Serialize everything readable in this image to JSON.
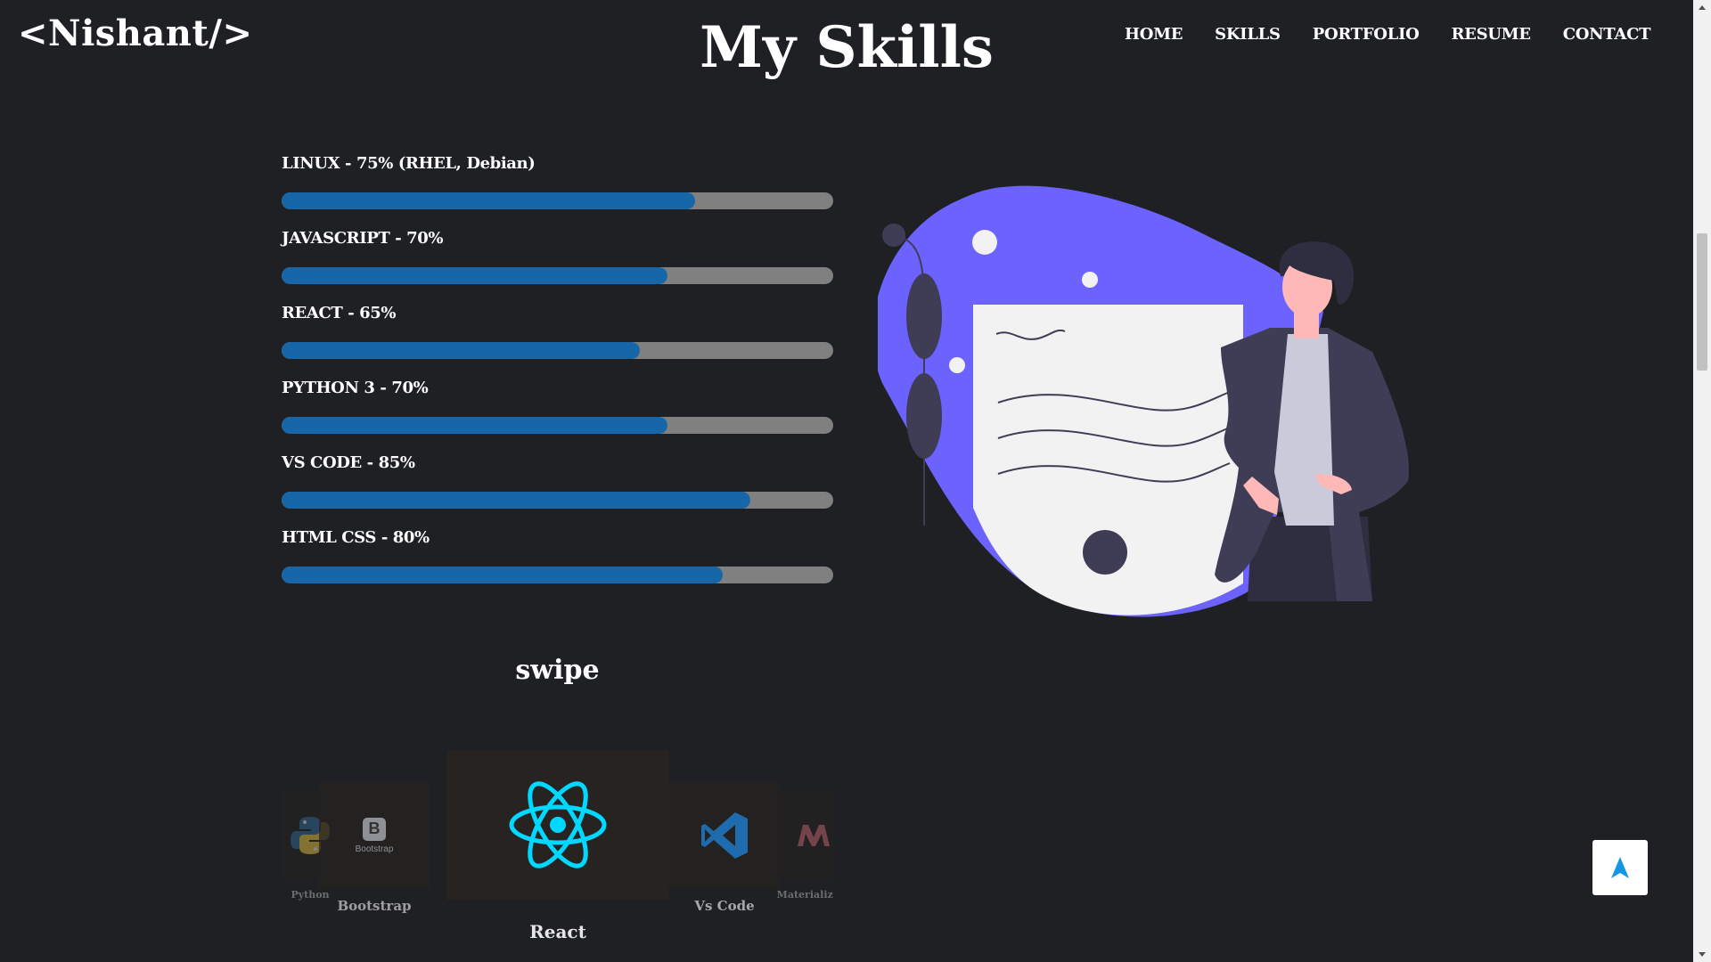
{
  "header": {
    "logo": "<Nishant/>",
    "title": "My Skills",
    "nav": [
      "HOME",
      "SKILLS",
      "PORTFOLIO",
      "RESUME",
      "CONTACT"
    ]
  },
  "skills": [
    {
      "label": "LINUX - 75% (RHEL, Debian)",
      "percent": 75
    },
    {
      "label": "JAVASCRIPT - 70%",
      "percent": 70
    },
    {
      "label": "REACT - 65%",
      "percent": 65
    },
    {
      "label": "PYTHON 3 - 70%",
      "percent": 70
    },
    {
      "label": "VS CODE - 85%",
      "percent": 85
    },
    {
      "label": "HTML CSS - 80%",
      "percent": 80
    }
  ],
  "swipe": {
    "title": "swipe",
    "cards": [
      {
        "name": "Python",
        "icon": "python-icon"
      },
      {
        "name": "Bootstrap",
        "icon": "bootstrap-icon",
        "icon_text": "Bootstrap"
      },
      {
        "name": "React",
        "icon": "react-icon"
      },
      {
        "name": "Vs Code",
        "icon": "vscode-icon"
      },
      {
        "name": "Materialize C",
        "icon": "materialize-icon"
      }
    ]
  },
  "colors": {
    "background": "#1e2023",
    "bar_fill": "#1766a7",
    "bar_track": "#808080",
    "blob": "#6c63ff",
    "react": "#00d8ff",
    "vscode": "#1f7fd1"
  }
}
